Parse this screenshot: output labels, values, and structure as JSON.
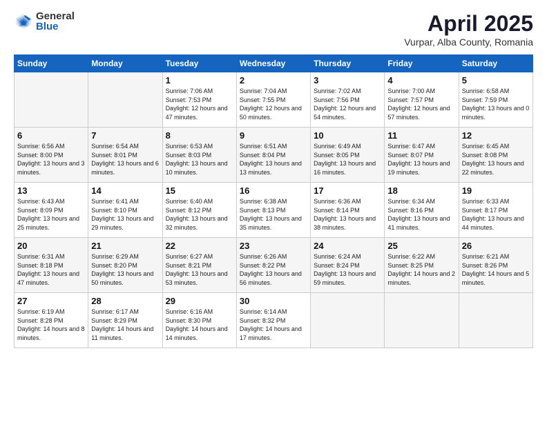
{
  "logo": {
    "general": "General",
    "blue": "Blue"
  },
  "title": "April 2025",
  "location": "Vurpar, Alba County, Romania",
  "headers": [
    "Sunday",
    "Monday",
    "Tuesday",
    "Wednesday",
    "Thursday",
    "Friday",
    "Saturday"
  ],
  "weeks": [
    [
      {
        "day": "",
        "info": ""
      },
      {
        "day": "",
        "info": ""
      },
      {
        "day": "1",
        "info": "Sunrise: 7:06 AM\nSunset: 7:53 PM\nDaylight: 12 hours and 47 minutes."
      },
      {
        "day": "2",
        "info": "Sunrise: 7:04 AM\nSunset: 7:55 PM\nDaylight: 12 hours and 50 minutes."
      },
      {
        "day": "3",
        "info": "Sunrise: 7:02 AM\nSunset: 7:56 PM\nDaylight: 12 hours and 54 minutes."
      },
      {
        "day": "4",
        "info": "Sunrise: 7:00 AM\nSunset: 7:57 PM\nDaylight: 12 hours and 57 minutes."
      },
      {
        "day": "5",
        "info": "Sunrise: 6:58 AM\nSunset: 7:59 PM\nDaylight: 13 hours and 0 minutes."
      }
    ],
    [
      {
        "day": "6",
        "info": "Sunrise: 6:56 AM\nSunset: 8:00 PM\nDaylight: 13 hours and 3 minutes."
      },
      {
        "day": "7",
        "info": "Sunrise: 6:54 AM\nSunset: 8:01 PM\nDaylight: 13 hours and 6 minutes."
      },
      {
        "day": "8",
        "info": "Sunrise: 6:53 AM\nSunset: 8:03 PM\nDaylight: 13 hours and 10 minutes."
      },
      {
        "day": "9",
        "info": "Sunrise: 6:51 AM\nSunset: 8:04 PM\nDaylight: 13 hours and 13 minutes."
      },
      {
        "day": "10",
        "info": "Sunrise: 6:49 AM\nSunset: 8:05 PM\nDaylight: 13 hours and 16 minutes."
      },
      {
        "day": "11",
        "info": "Sunrise: 6:47 AM\nSunset: 8:07 PM\nDaylight: 13 hours and 19 minutes."
      },
      {
        "day": "12",
        "info": "Sunrise: 6:45 AM\nSunset: 8:08 PM\nDaylight: 13 hours and 22 minutes."
      }
    ],
    [
      {
        "day": "13",
        "info": "Sunrise: 6:43 AM\nSunset: 8:09 PM\nDaylight: 13 hours and 25 minutes."
      },
      {
        "day": "14",
        "info": "Sunrise: 6:41 AM\nSunset: 8:10 PM\nDaylight: 13 hours and 29 minutes."
      },
      {
        "day": "15",
        "info": "Sunrise: 6:40 AM\nSunset: 8:12 PM\nDaylight: 13 hours and 32 minutes."
      },
      {
        "day": "16",
        "info": "Sunrise: 6:38 AM\nSunset: 8:13 PM\nDaylight: 13 hours and 35 minutes."
      },
      {
        "day": "17",
        "info": "Sunrise: 6:36 AM\nSunset: 8:14 PM\nDaylight: 13 hours and 38 minutes."
      },
      {
        "day": "18",
        "info": "Sunrise: 6:34 AM\nSunset: 8:16 PM\nDaylight: 13 hours and 41 minutes."
      },
      {
        "day": "19",
        "info": "Sunrise: 6:33 AM\nSunset: 8:17 PM\nDaylight: 13 hours and 44 minutes."
      }
    ],
    [
      {
        "day": "20",
        "info": "Sunrise: 6:31 AM\nSunset: 8:18 PM\nDaylight: 13 hours and 47 minutes."
      },
      {
        "day": "21",
        "info": "Sunrise: 6:29 AM\nSunset: 8:20 PM\nDaylight: 13 hours and 50 minutes."
      },
      {
        "day": "22",
        "info": "Sunrise: 6:27 AM\nSunset: 8:21 PM\nDaylight: 13 hours and 53 minutes."
      },
      {
        "day": "23",
        "info": "Sunrise: 6:26 AM\nSunset: 8:22 PM\nDaylight: 13 hours and 56 minutes."
      },
      {
        "day": "24",
        "info": "Sunrise: 6:24 AM\nSunset: 8:24 PM\nDaylight: 13 hours and 59 minutes."
      },
      {
        "day": "25",
        "info": "Sunrise: 6:22 AM\nSunset: 8:25 PM\nDaylight: 14 hours and 2 minutes."
      },
      {
        "day": "26",
        "info": "Sunrise: 6:21 AM\nSunset: 8:26 PM\nDaylight: 14 hours and 5 minutes."
      }
    ],
    [
      {
        "day": "27",
        "info": "Sunrise: 6:19 AM\nSunset: 8:28 PM\nDaylight: 14 hours and 8 minutes."
      },
      {
        "day": "28",
        "info": "Sunrise: 6:17 AM\nSunset: 8:29 PM\nDaylight: 14 hours and 11 minutes."
      },
      {
        "day": "29",
        "info": "Sunrise: 6:16 AM\nSunset: 8:30 PM\nDaylight: 14 hours and 14 minutes."
      },
      {
        "day": "30",
        "info": "Sunrise: 6:14 AM\nSunset: 8:32 PM\nDaylight: 14 hours and 17 minutes."
      },
      {
        "day": "",
        "info": ""
      },
      {
        "day": "",
        "info": ""
      },
      {
        "day": "",
        "info": ""
      }
    ]
  ]
}
